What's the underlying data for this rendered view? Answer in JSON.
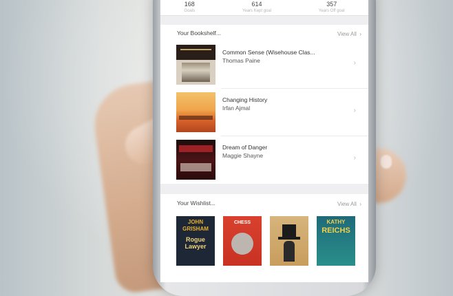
{
  "stats": [
    {
      "value": "168",
      "label": "Goals"
    },
    {
      "value": "614",
      "label": "Years Kept goal"
    },
    {
      "value": "357",
      "label": "Years Off goal"
    }
  ],
  "bookshelf": {
    "title": "Your Bookshelf...",
    "view_all": "View All",
    "books": [
      {
        "title": "Common Sense (Wisehouse Clas...",
        "author": "Thomas Paine",
        "cover": "common-sense-cover"
      },
      {
        "title": "Changing History",
        "author": "Irfan Ajmal",
        "cover": "changing-history-cover"
      },
      {
        "title": "Dream of Danger",
        "author": "Maggie Shayne",
        "cover": "dream-of-danger-cover"
      }
    ]
  },
  "wishlist": {
    "title": "Your Wishlist...",
    "view_all": "View All",
    "books": [
      {
        "cover_text_1": "JOHN",
        "cover_text_2": "GRISHAM",
        "cover_text_3": "Rogue Lawyer",
        "cover": "rogue-lawyer-cover"
      },
      {
        "cover_text_1": "CHESS",
        "cover": "chess-cover"
      },
      {
        "cover": "top-hat-cover"
      },
      {
        "cover_text_1": "KATHY",
        "cover_text_2": "REICHS",
        "cover": "reichs-cover"
      }
    ]
  },
  "chevron": "›",
  "colors": {
    "screen_bg": "#ffffff",
    "section_gap": "#efeff2",
    "muted_text": "#9a9a9a"
  }
}
